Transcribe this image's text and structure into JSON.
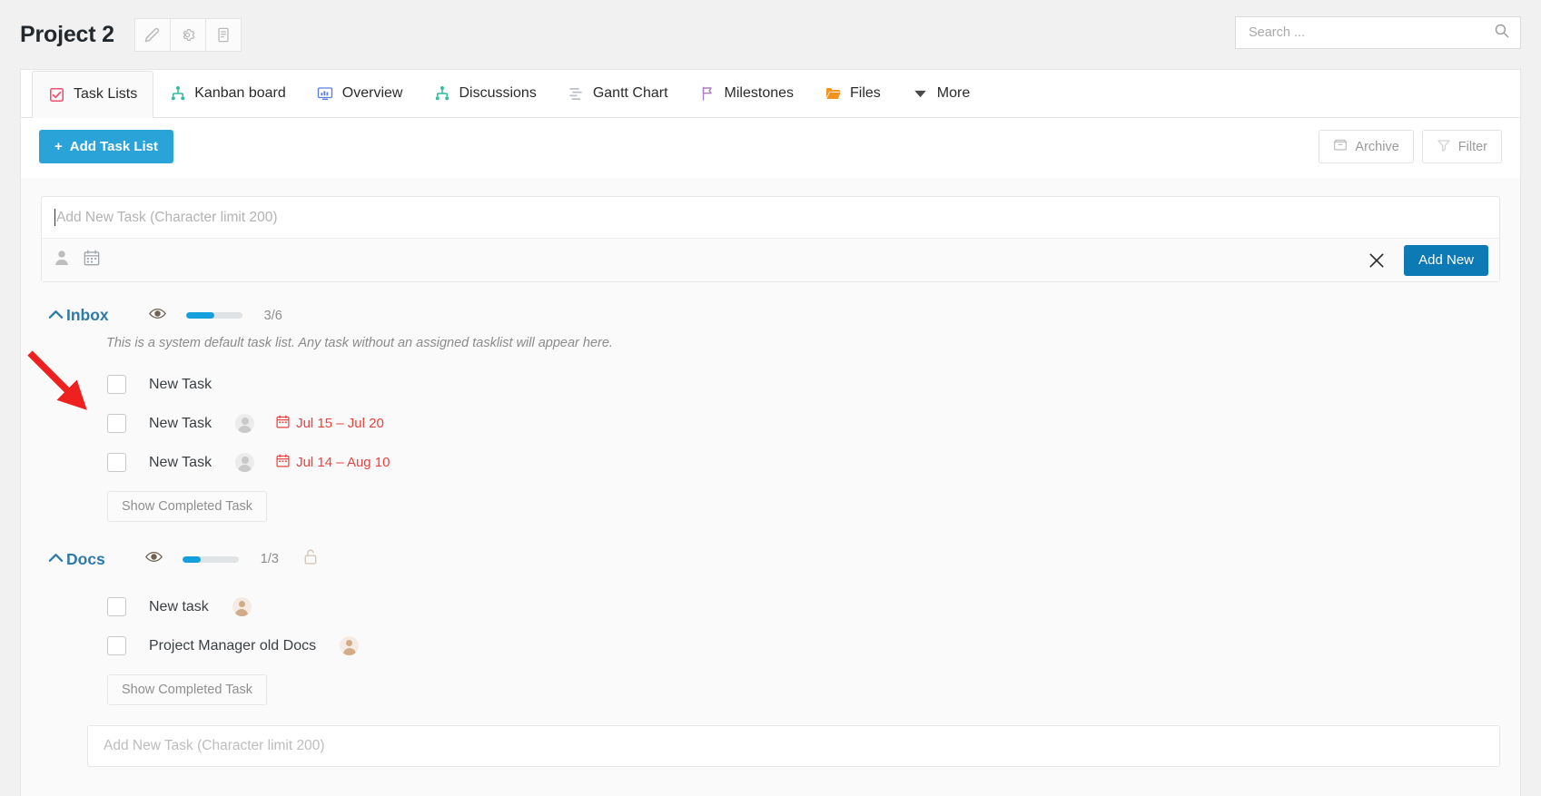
{
  "header": {
    "project_title": "Project 2",
    "buttons": [
      {
        "name": "edit-project",
        "icon": "pencil-icon"
      },
      {
        "name": "project-settings",
        "icon": "gear-icon"
      },
      {
        "name": "project-notes",
        "icon": "document-icon"
      }
    ],
    "search": {
      "placeholder": "Search ...",
      "value": "",
      "icon": "search-icon"
    }
  },
  "tabs": [
    {
      "label": "Task Lists",
      "icon": "checklist-icon",
      "active": true
    },
    {
      "label": "Kanban board",
      "icon": "kanban-icon",
      "active": false
    },
    {
      "label": "Overview",
      "icon": "overview-icon",
      "active": false
    },
    {
      "label": "Discussions",
      "icon": "discussions-icon",
      "active": false
    },
    {
      "label": "Gantt Chart",
      "icon": "gantt-icon",
      "active": false
    },
    {
      "label": "Milestones",
      "icon": "flag-icon",
      "active": false
    },
    {
      "label": "Files",
      "icon": "folder-icon",
      "active": false
    },
    {
      "label": "More",
      "icon": "chevron-down-icon",
      "active": false
    }
  ],
  "toolbar": {
    "add_task_list_label": "Add Task List",
    "add_task_list_plus": "+",
    "archive_label": "Archive",
    "filter_label": "Filter"
  },
  "composer": {
    "placeholder": "Add New Task (Character limit 200)",
    "value": "",
    "assignee_icon": "user-icon",
    "date_icon": "calendar-icon",
    "close_icon": "close-icon",
    "add_new_label": "Add New"
  },
  "task_lists": [
    {
      "name": "Inbox",
      "description": "This is a system default task list. Any task without an assigned tasklist will appear here.",
      "progress_text": "3/6",
      "progress_pct": 50,
      "locked": false,
      "show_completed_label": "Show Completed Task",
      "tasks": [
        {
          "title": "New Task",
          "assignee": "none",
          "date": ""
        },
        {
          "title": "New Task",
          "assignee": "gray",
          "date": "Jul 15 – Jul 20"
        },
        {
          "title": "New Task",
          "assignee": "gray",
          "date": "Jul 14 – Aug 10"
        }
      ]
    },
    {
      "name": "Docs",
      "description": "",
      "progress_text": "1/3",
      "progress_pct": 33,
      "locked": true,
      "show_completed_label": "Show Completed Task",
      "tasks": [
        {
          "title": "New task",
          "assignee": "photo",
          "date": ""
        },
        {
          "title": "Project Manager old Docs",
          "assignee": "photo",
          "date": ""
        }
      ]
    }
  ],
  "bottom_composer": {
    "placeholder": "Add New Task (Character limit 200)"
  },
  "annotation": {
    "type": "arrow",
    "color": "#ef2929",
    "points_to": "first-task-checkbox"
  },
  "colors": {
    "accent_blue": "#29a3d8",
    "button_blue": "#0d7ab5",
    "list_title": "#2e7aa8",
    "date_red": "#e8423f",
    "page_bg": "#f1f1f1",
    "panel_bg": "#fafafa"
  }
}
